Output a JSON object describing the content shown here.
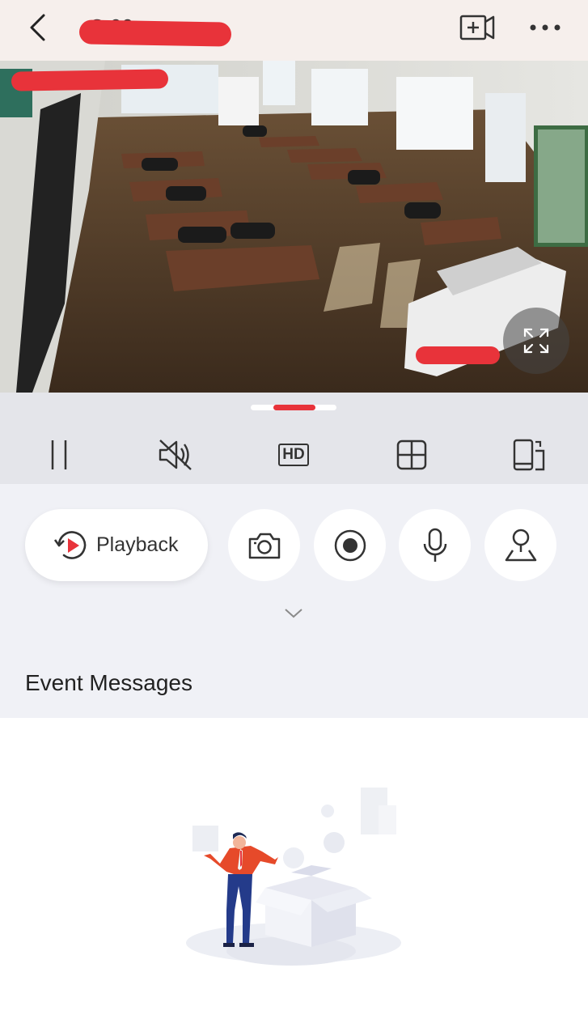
{
  "header": {
    "title": "C          00"
  },
  "controls": {
    "quality_label": "HD"
  },
  "actions": {
    "playback_label": "Playback"
  },
  "events": {
    "section_title": "Event Messages"
  },
  "colors": {
    "accent": "#e8333a",
    "controls_bg": "#e4e5ea",
    "actions_bg": "#f0f1f6",
    "topbar_bg": "#f6efec"
  },
  "icons": {
    "back": "chevron-left-icon",
    "add_camera": "video-plus-icon",
    "more": "more-horizontal-icon",
    "pause": "pause-icon",
    "mute": "speaker-muted-icon",
    "quality": "hd-icon",
    "layout": "grid-icon",
    "rotate": "device-rotate-icon",
    "fullscreen": "fullscreen-icon",
    "playback": "playback-history-icon",
    "snapshot": "camera-icon",
    "record": "record-icon",
    "talk": "microphone-icon",
    "ptz": "ptz-control-icon",
    "expand": "chevron-down-icon"
  }
}
